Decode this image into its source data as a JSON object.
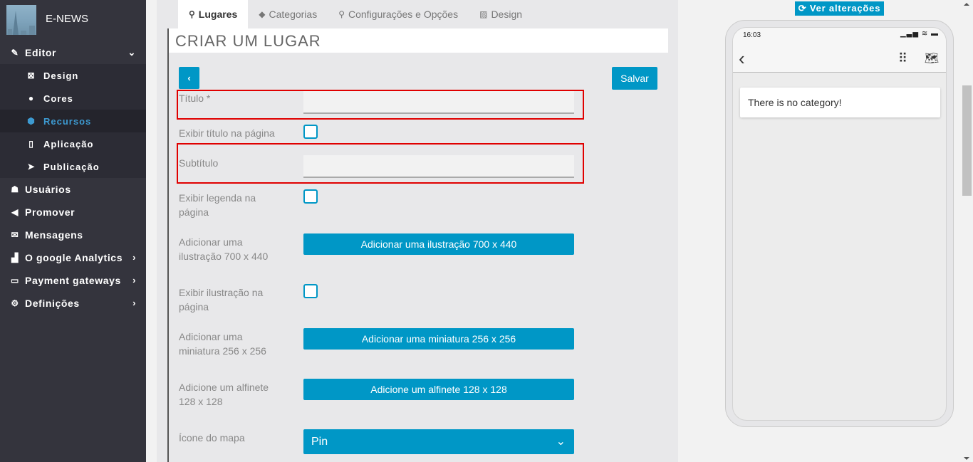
{
  "brand": {
    "name": "E-NEWS"
  },
  "sidebar": {
    "items": [
      {
        "label": "Editor",
        "icon": "pencil-icon",
        "expanded": true,
        "children": [
          {
            "label": "Design",
            "icon": "design-icon"
          },
          {
            "label": "Cores",
            "icon": "palette-icon"
          },
          {
            "label": "Recursos",
            "icon": "cube-icon",
            "active": true
          },
          {
            "label": "Aplicação",
            "icon": "mobile-icon"
          },
          {
            "label": "Publicação",
            "icon": "paper-plane-icon"
          }
        ]
      },
      {
        "label": "Usuários",
        "icon": "users-icon"
      },
      {
        "label": "Promover",
        "icon": "bullhorn-icon"
      },
      {
        "label": "Mensagens",
        "icon": "envelope-icon"
      },
      {
        "label": "O google Analytics",
        "icon": "chart-icon",
        "has_submenu": true
      },
      {
        "label": "Payment gateways",
        "icon": "credit-card-icon",
        "has_submenu": true
      },
      {
        "label": "Definições",
        "icon": "cogs-icon",
        "has_submenu": true
      }
    ]
  },
  "tabs": [
    {
      "label": "Lugares",
      "icon": "map-marker-icon",
      "active": true
    },
    {
      "label": "Categorias",
      "icon": "tags-icon"
    },
    {
      "label": "Configurações e Opções",
      "icon": "search-icon"
    },
    {
      "label": "Design",
      "icon": "image-icon"
    }
  ],
  "form": {
    "title": "CRIAR UM LUGAR",
    "back_label": "‹",
    "save_label": "Salvar",
    "fields": {
      "titulo": {
        "label": "Título *",
        "value": ""
      },
      "exibir_titulo": {
        "label": "Exibir título na página",
        "checked": false
      },
      "subtitulo": {
        "label": "Subtítulo",
        "value": ""
      },
      "exibir_legenda": {
        "label": "Exibir legenda na página",
        "checked": false
      },
      "ilustracao": {
        "label": "Adicionar uma ilustração 700 x 440",
        "button": "Adicionar uma ilustração 700 x 440"
      },
      "exibir_ilustracao": {
        "label": "Exibir ilustração na página",
        "checked": false
      },
      "miniatura": {
        "label": "Adicionar uma miniatura 256 x 256",
        "button": "Adicionar uma miniatura 256 x 256"
      },
      "alfinete": {
        "label": "Adicione um alfinete 128 x 128",
        "button": "Adicione um alfinete 128 x 128"
      },
      "icone_mapa": {
        "label": "Ícone do mapa",
        "selected": "Pin"
      }
    }
  },
  "preview": {
    "button_label": "Ver alterações",
    "status_time": "16:03",
    "message": "There is no category!"
  },
  "colors": {
    "accent": "#0097c6",
    "sidebar_bg": "#34343d",
    "sidebar_active_text": "#3d9ad1",
    "highlight_border": "#e00000"
  }
}
